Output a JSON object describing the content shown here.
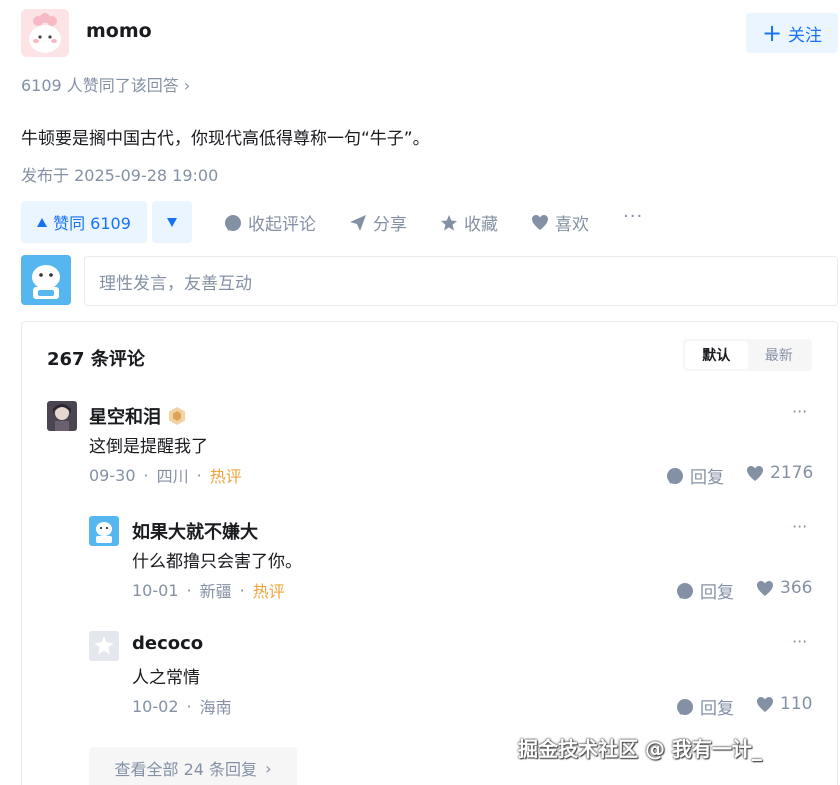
{
  "author": {
    "name": "momo",
    "follow_label": "关注"
  },
  "answer": {
    "upvoted_line": "6109 人赞同了该回答 ›",
    "text": "牛顿要是搁中国古代，你现代高低得尊称一句“牛子”。",
    "published": "发布于 2025-09-28 19:00"
  },
  "actions": {
    "vote_up": "赞同 6109",
    "collapse_comments": "收起评论",
    "share": "分享",
    "favorite": "收藏",
    "like": "喜欢",
    "more": "···"
  },
  "comment_box": {
    "placeholder": "理性发言，友善互动"
  },
  "comments": {
    "count_label": "267 条评论",
    "sort": [
      "默认",
      "最新"
    ],
    "more": "···",
    "reply_label": "回复",
    "items": [
      {
        "name": "星空和泪",
        "text": "这倒是提醒我了",
        "date": "09-30",
        "location": "四川",
        "hot": "热评",
        "likes": "2176"
      },
      {
        "name": "如果大就不嫌大",
        "text": "什么都撸只会害了你。",
        "date": "10-01",
        "location": "新疆",
        "hot": "热评",
        "likes": "366"
      },
      {
        "name": "decoco",
        "text": "人之常情",
        "date": "10-02",
        "location": "海南",
        "hot": "",
        "likes": "110"
      }
    ],
    "view_all": "查看全部 24 条回复"
  },
  "watermark": "掘金技术社区 @ 我有一计_",
  "colors": {
    "accent": "#1772f6",
    "accent_bg": "#ebf5ff",
    "muted": "#8491a5",
    "hot": "#f1a33a"
  }
}
